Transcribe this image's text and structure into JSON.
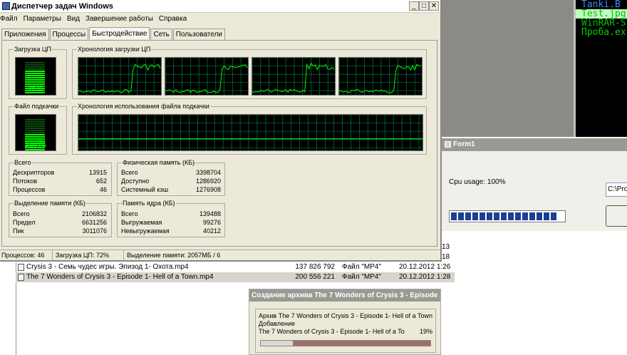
{
  "taskmgr": {
    "title": "Диспетчер задач Windows",
    "menu": [
      "Файл",
      "Параметры",
      "Вид",
      "Завершение работы",
      "Справка"
    ],
    "tabs": [
      "Приложения",
      "Процессы",
      "Быстродействие",
      "Сеть",
      "Пользователи"
    ],
    "active_tab": "Быстродействие",
    "cpu_group_label": "Загрузка ЦП",
    "cpu_value": "72 %",
    "cpu_level": 0.72,
    "cpu_history_label": "Хронология загрузки ЦП",
    "pagefile_group_label": "Файл подкачки",
    "pagefile_value": "2,00 ГБ",
    "pagefile_level": 0.5,
    "pagefile_history_label": "Хронология использования файла подкачки",
    "totals": {
      "label": "Всего",
      "rows": [
        {
          "k": "Дескрипторов",
          "v": "13915"
        },
        {
          "k": "Потоков",
          "v": "652"
        },
        {
          "k": "Процессов",
          "v": "46"
        }
      ]
    },
    "phys": {
      "label": "Физическая память (КБ)",
      "rows": [
        {
          "k": "Всего",
          "v": "3398704"
        },
        {
          "k": "Доступно",
          "v": "1286920"
        },
        {
          "k": "Системный кэш",
          "v": "1276908"
        }
      ]
    },
    "commit": {
      "label": "Выделение памяти (КБ)",
      "rows": [
        {
          "k": "Всего",
          "v": "2106832"
        },
        {
          "k": "Предел",
          "v": "6631256"
        },
        {
          "k": "Пик",
          "v": "3011076"
        }
      ]
    },
    "kernel": {
      "label": "Память ядра (КБ)",
      "rows": [
        {
          "k": "Всего",
          "v": "139488"
        },
        {
          "k": "Выгружаемая",
          "v": "99276"
        },
        {
          "k": "Невыгружаемая",
          "v": "40212"
        }
      ]
    },
    "status": {
      "processes": "Процессов: 46",
      "cpu": "Загрузка ЦП: 72%",
      "commit": "Выделение памяти: 2057МБ / 6"
    },
    "colors": {
      "graph_line": "#00ff00",
      "grid": "#008040",
      "meter_on": "#00ff00",
      "meter_off": "#0a4d0a"
    }
  },
  "console": {
    "lines": [
      {
        "text": "Tanki.B",
        "color": "#3c8cff"
      },
      {
        "text": "Test.jpg",
        "color": "#00c000",
        "bg": "#bfffbf"
      },
      {
        "text": "WinRAR-S",
        "color": "#00c000"
      },
      {
        "text": "Проба.ex",
        "color": "#00d000"
      }
    ]
  },
  "form1": {
    "title": "Form1",
    "cpu_label": "Cpu usage: 100%",
    "path_value": "C:\\Pro",
    "progress_blocks": 15
  },
  "files": {
    "partial_rows": [
      {
        "date_tail": "13"
      },
      {
        "date_tail": "18"
      }
    ],
    "rows": [
      {
        "name": "Crysis 3 - Семь чудес игры. Эпизод 1- Охота.mp4",
        "size": "137 826 792",
        "type": "Файл \"MP4\"",
        "date": "20.12.2012 1:26",
        "selected": false
      },
      {
        "name": "The 7 Wonders of Crysis 3 - Episode 1- Hell of a Town.mp4",
        "size": "200 556 221",
        "type": "Файл \"MP4\"",
        "date": "20.12.2012 1:28",
        "selected": true
      }
    ]
  },
  "archive": {
    "title": "Создание архива The 7 Wonders of Crysis 3 - Episode ...",
    "archive_line": "Архив The 7 Wonders of Crysis 3 - Episode 1- Hell of a Town",
    "action": "Добавление",
    "file_line": "The 7 Wonders of Crysis 3 - Episode 1- Hell of a To",
    "percent": "19%",
    "progress": 0.19
  }
}
